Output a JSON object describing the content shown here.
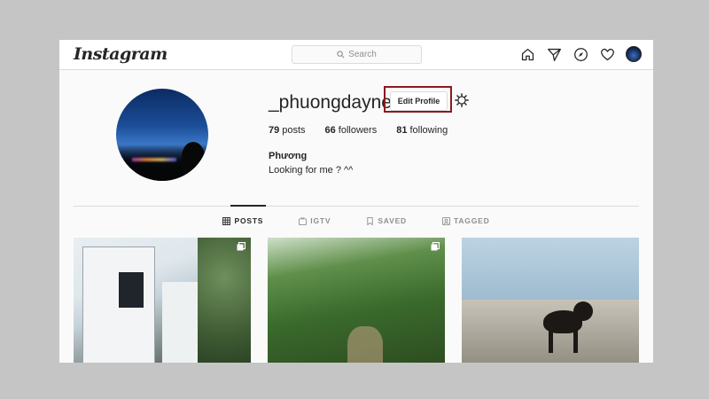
{
  "topbar": {
    "logo": "Instagram",
    "search_placeholder": "Search",
    "icons": [
      "home-icon",
      "direct-icon",
      "explore-icon",
      "activity-icon",
      "profile-avatar"
    ]
  },
  "profile": {
    "username": "_phuongdayne_",
    "edit_button": "Edit Profile",
    "stats": {
      "posts_count": "79",
      "posts_label": "posts",
      "followers_count": "66",
      "followers_label": "followers",
      "following_count": "81",
      "following_label": "following"
    },
    "full_name": "Phương",
    "bio": "Looking for me ? ^^"
  },
  "tabs": [
    {
      "label": "POSTS",
      "icon": "grid-icon",
      "active": true
    },
    {
      "label": "IGTV",
      "icon": "tv-icon",
      "active": false
    },
    {
      "label": "SAVED",
      "icon": "bookmark-icon",
      "active": false
    },
    {
      "label": "TAGGED",
      "icon": "tag-icon",
      "active": false
    }
  ],
  "colors": {
    "highlight_box": "#8b1a1f",
    "background": "#fafafa",
    "border": "#dbdbdb"
  }
}
